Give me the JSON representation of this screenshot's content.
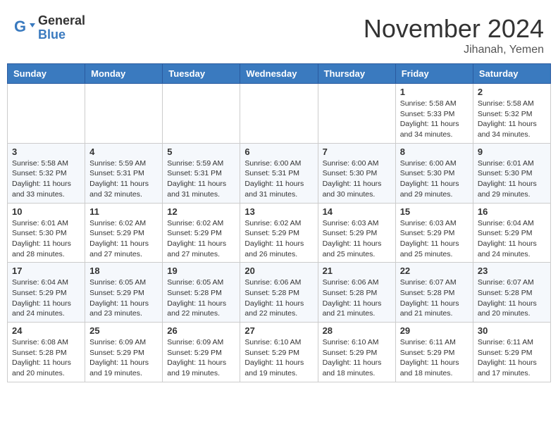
{
  "header": {
    "logo_general": "General",
    "logo_blue": "Blue",
    "month_title": "November 2024",
    "location": "Jihanah, Yemen"
  },
  "weekdays": [
    "Sunday",
    "Monday",
    "Tuesday",
    "Wednesday",
    "Thursday",
    "Friday",
    "Saturday"
  ],
  "weeks": [
    [
      {
        "day": "",
        "info": ""
      },
      {
        "day": "",
        "info": ""
      },
      {
        "day": "",
        "info": ""
      },
      {
        "day": "",
        "info": ""
      },
      {
        "day": "",
        "info": ""
      },
      {
        "day": "1",
        "info": "Sunrise: 5:58 AM\nSunset: 5:33 PM\nDaylight: 11 hours and 34 minutes."
      },
      {
        "day": "2",
        "info": "Sunrise: 5:58 AM\nSunset: 5:32 PM\nDaylight: 11 hours and 34 minutes."
      }
    ],
    [
      {
        "day": "3",
        "info": "Sunrise: 5:58 AM\nSunset: 5:32 PM\nDaylight: 11 hours and 33 minutes."
      },
      {
        "day": "4",
        "info": "Sunrise: 5:59 AM\nSunset: 5:31 PM\nDaylight: 11 hours and 32 minutes."
      },
      {
        "day": "5",
        "info": "Sunrise: 5:59 AM\nSunset: 5:31 PM\nDaylight: 11 hours and 31 minutes."
      },
      {
        "day": "6",
        "info": "Sunrise: 6:00 AM\nSunset: 5:31 PM\nDaylight: 11 hours and 31 minutes."
      },
      {
        "day": "7",
        "info": "Sunrise: 6:00 AM\nSunset: 5:30 PM\nDaylight: 11 hours and 30 minutes."
      },
      {
        "day": "8",
        "info": "Sunrise: 6:00 AM\nSunset: 5:30 PM\nDaylight: 11 hours and 29 minutes."
      },
      {
        "day": "9",
        "info": "Sunrise: 6:01 AM\nSunset: 5:30 PM\nDaylight: 11 hours and 29 minutes."
      }
    ],
    [
      {
        "day": "10",
        "info": "Sunrise: 6:01 AM\nSunset: 5:30 PM\nDaylight: 11 hours and 28 minutes."
      },
      {
        "day": "11",
        "info": "Sunrise: 6:02 AM\nSunset: 5:29 PM\nDaylight: 11 hours and 27 minutes."
      },
      {
        "day": "12",
        "info": "Sunrise: 6:02 AM\nSunset: 5:29 PM\nDaylight: 11 hours and 27 minutes."
      },
      {
        "day": "13",
        "info": "Sunrise: 6:02 AM\nSunset: 5:29 PM\nDaylight: 11 hours and 26 minutes."
      },
      {
        "day": "14",
        "info": "Sunrise: 6:03 AM\nSunset: 5:29 PM\nDaylight: 11 hours and 25 minutes."
      },
      {
        "day": "15",
        "info": "Sunrise: 6:03 AM\nSunset: 5:29 PM\nDaylight: 11 hours and 25 minutes."
      },
      {
        "day": "16",
        "info": "Sunrise: 6:04 AM\nSunset: 5:29 PM\nDaylight: 11 hours and 24 minutes."
      }
    ],
    [
      {
        "day": "17",
        "info": "Sunrise: 6:04 AM\nSunset: 5:29 PM\nDaylight: 11 hours and 24 minutes."
      },
      {
        "day": "18",
        "info": "Sunrise: 6:05 AM\nSunset: 5:29 PM\nDaylight: 11 hours and 23 minutes."
      },
      {
        "day": "19",
        "info": "Sunrise: 6:05 AM\nSunset: 5:28 PM\nDaylight: 11 hours and 22 minutes."
      },
      {
        "day": "20",
        "info": "Sunrise: 6:06 AM\nSunset: 5:28 PM\nDaylight: 11 hours and 22 minutes."
      },
      {
        "day": "21",
        "info": "Sunrise: 6:06 AM\nSunset: 5:28 PM\nDaylight: 11 hours and 21 minutes."
      },
      {
        "day": "22",
        "info": "Sunrise: 6:07 AM\nSunset: 5:28 PM\nDaylight: 11 hours and 21 minutes."
      },
      {
        "day": "23",
        "info": "Sunrise: 6:07 AM\nSunset: 5:28 PM\nDaylight: 11 hours and 20 minutes."
      }
    ],
    [
      {
        "day": "24",
        "info": "Sunrise: 6:08 AM\nSunset: 5:28 PM\nDaylight: 11 hours and 20 minutes."
      },
      {
        "day": "25",
        "info": "Sunrise: 6:09 AM\nSunset: 5:29 PM\nDaylight: 11 hours and 19 minutes."
      },
      {
        "day": "26",
        "info": "Sunrise: 6:09 AM\nSunset: 5:29 PM\nDaylight: 11 hours and 19 minutes."
      },
      {
        "day": "27",
        "info": "Sunrise: 6:10 AM\nSunset: 5:29 PM\nDaylight: 11 hours and 19 minutes."
      },
      {
        "day": "28",
        "info": "Sunrise: 6:10 AM\nSunset: 5:29 PM\nDaylight: 11 hours and 18 minutes."
      },
      {
        "day": "29",
        "info": "Sunrise: 6:11 AM\nSunset: 5:29 PM\nDaylight: 11 hours and 18 minutes."
      },
      {
        "day": "30",
        "info": "Sunrise: 6:11 AM\nSunset: 5:29 PM\nDaylight: 11 hours and 17 minutes."
      }
    ]
  ]
}
